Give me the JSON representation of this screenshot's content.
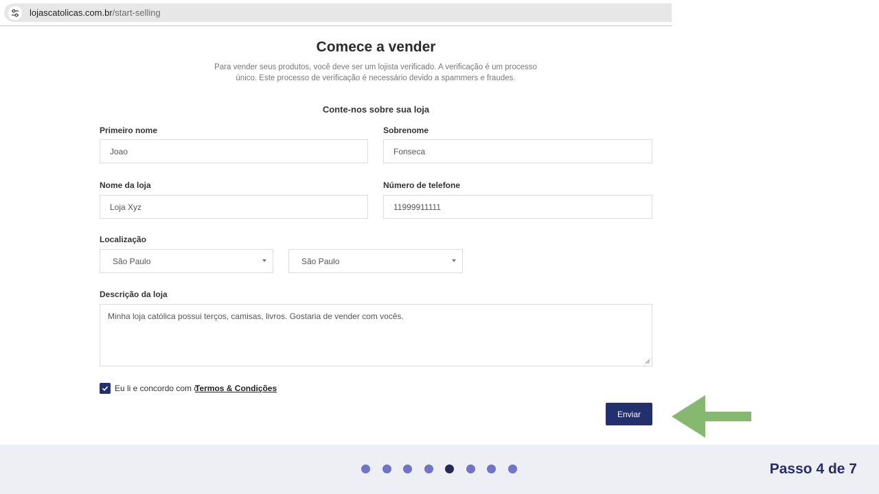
{
  "browser": {
    "url_domain": "lojascatolicas.com.br",
    "url_path": "/start-selling",
    "site_controls_icon": "tune-icon"
  },
  "form": {
    "title": "Comece a vender",
    "intro": "Para vender seus produtos, você deve ser um lojista verificado. A verificação é um processo único. Este processo de verificação é necessário devido a spammers e fraudes.",
    "section_title": "Conte-nos sobre sua loja",
    "first_name": {
      "label": "Primeiro nome",
      "value": "Joao"
    },
    "last_name": {
      "label": "Sobrenome",
      "value": "Fonseca"
    },
    "store_name": {
      "label": "Nome da loja",
      "value": "Loja Xyz"
    },
    "phone": {
      "label": "Número de telefone",
      "value": "11999911111"
    },
    "location": {
      "label": "Localização",
      "state": "São Paulo",
      "city": "São Paulo"
    },
    "description": {
      "label": "Descrição da loja",
      "value": "Minha loja católica possui terços, camisas, livros. Gostaria de vender com vocês."
    },
    "terms": {
      "checked": true,
      "text": "Eu li e concordo com o",
      "link": "Termos & Condições"
    },
    "submit_label": "Enviar"
  },
  "annotation": {
    "arrow_color": "#86b870",
    "arrow_direction": "left"
  },
  "progress": {
    "step_label": "Passo 4 de 7",
    "dots": 8,
    "active_dot": 5,
    "dot_color": "#6f73c9",
    "active_color": "#262858"
  }
}
